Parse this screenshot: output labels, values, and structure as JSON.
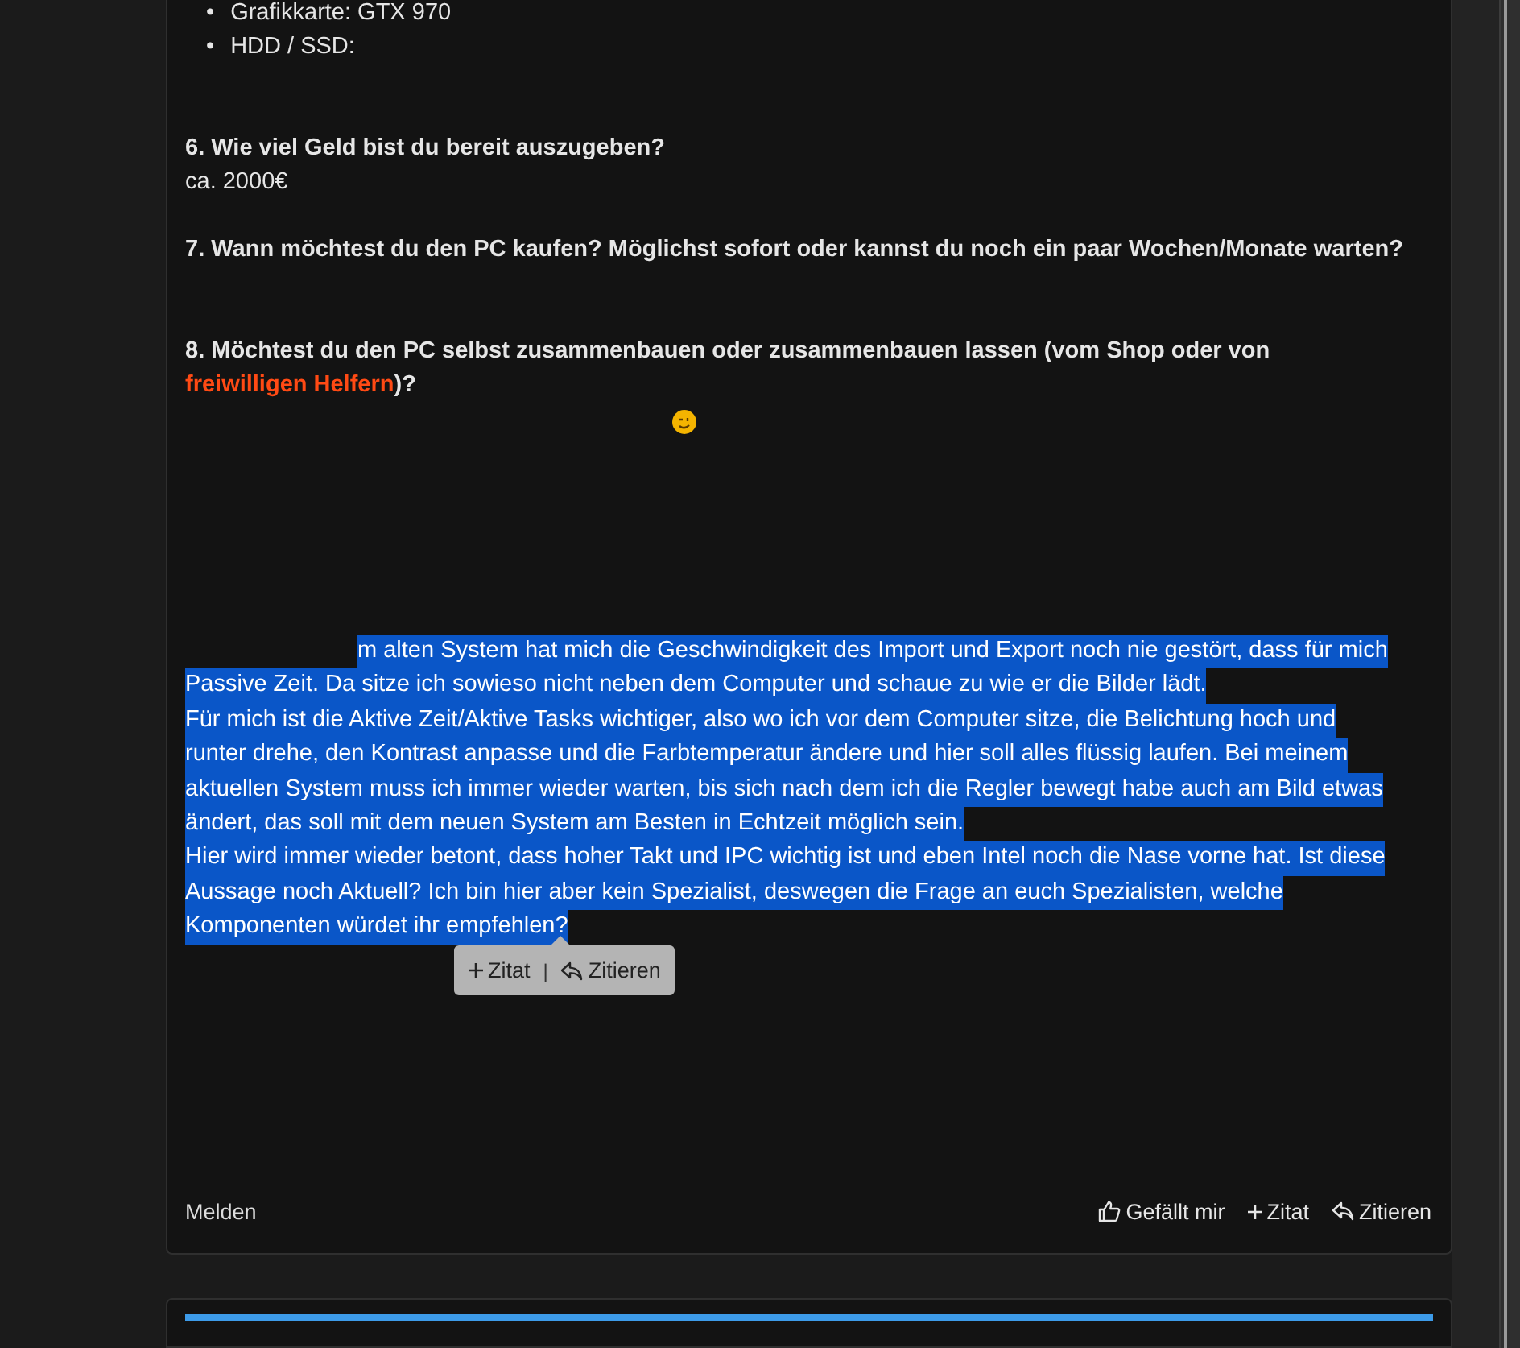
{
  "specs": [
    {
      "marker": "•",
      "text": "Grafikkarte: GTX 970"
    },
    {
      "marker": "•",
      "text": "HDD / SSD:"
    }
  ],
  "questions": [
    {
      "question": "6. Wie viel Geld bist du bereit auszugeben?",
      "answer": "ca. 2000€"
    },
    {
      "question": "7. Wann möchtest du den PC kaufen? Möglichst sofort oder kannst du noch ein paar Wochen/Monate warten?"
    },
    {
      "question": "8. Möchtest du den PC selbst zusammenbauen oder zusammenbauen lassen (vom Shop oder von ",
      "link": "freiwilligen Helfern",
      "after": ")?"
    }
  ],
  "selected_text": [
    "m alten System hat mich die Geschwindigkeit des Import und Export noch nie gestört, dass für mich",
    "Passive Zeit. Da sitze ich sowieso nicht neben dem Computer und schaue zu wie er die Bilder lädt.",
    "Für mich ist die Aktive Zeit/Aktive Tasks wichtiger, also wo ich vor dem Computer sitze, die Belichtung hoch und",
    "runter drehe, den Kontrast anpasse und die Farbtemperatur ändere und hier soll alles flüssig laufen. Bei meinem",
    "aktuellen System muss ich immer wieder warten, bis sich nach dem ich die Regler bewegt habe auch am Bild etwas",
    "ändert, das soll mit dem neuen System am Besten in Echtzeit möglich sein.",
    "Hier wird immer wieder betont, dass hoher Takt und IPC wichtig ist und eben Intel noch die Nase vorne hat. Ist diese",
    "Aussage noch Aktuell? Ich bin hier aber kein Spezialist, deswegen die Frage an euch Spezialisten, welche",
    "Komponenten würdet ihr empfehlen?"
  ],
  "quote_popup": {
    "separator": "|",
    "actions": [
      {
        "kind": "plus",
        "label": "Zitat"
      },
      {
        "kind": "reply",
        "label": "Zitieren"
      }
    ]
  },
  "footer": {
    "report": "Melden",
    "actions": [
      {
        "kind": "like",
        "label": "Gefällt mir"
      },
      {
        "kind": "plus",
        "label": "Zitat"
      },
      {
        "kind": "reply",
        "label": "Zitieren"
      }
    ]
  }
}
